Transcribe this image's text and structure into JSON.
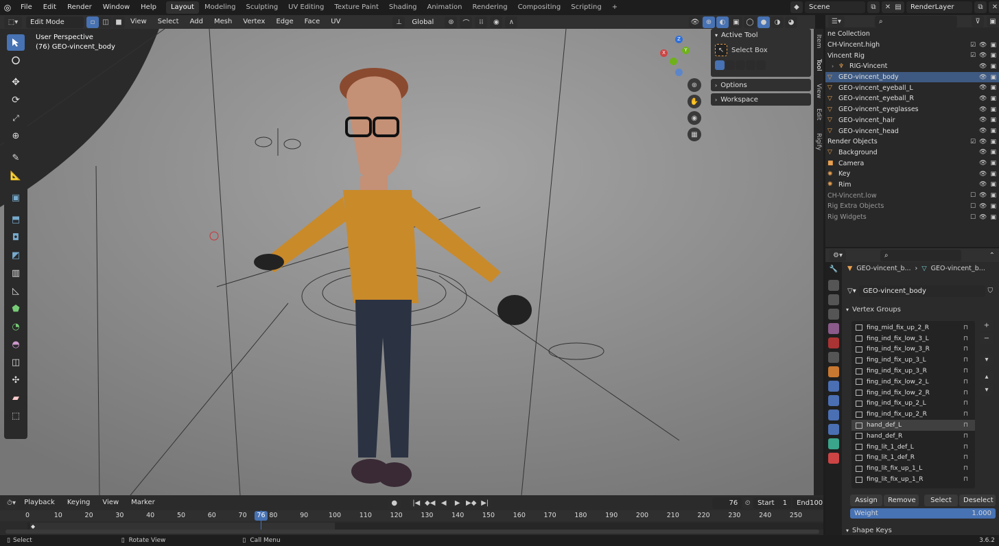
{
  "menu": {
    "items": [
      "File",
      "Edit",
      "Render",
      "Window",
      "Help"
    ]
  },
  "workspaces": [
    "Layout",
    "Modeling",
    "Sculpting",
    "UV Editing",
    "Texture Paint",
    "Shading",
    "Animation",
    "Rendering",
    "Compositing",
    "Scripting"
  ],
  "workspace_add": "+",
  "scene": {
    "name": "Scene",
    "layer": "RenderLayer"
  },
  "viewport_header": {
    "mode": "Edit Mode",
    "menus": [
      "View",
      "Select",
      "Add",
      "Mesh",
      "Vertex",
      "Edge",
      "Face",
      "UV"
    ],
    "orientation": "Global"
  },
  "viewport": {
    "perspective": "User Perspective",
    "object_label": "(76) GEO-vincent_body",
    "gizmo_axes": [
      "Z",
      "Y",
      "X"
    ]
  },
  "npanel": {
    "active_tool_title": "Active Tool",
    "select_box": "Select Box",
    "options": "Options",
    "workspace": "Workspace",
    "tabs": [
      "Item",
      "Tool",
      "View",
      "Edit",
      "Rigify"
    ]
  },
  "outliner": {
    "root": "ne Collection",
    "rows": [
      {
        "name": "CH-Vincent.high",
        "dim": false,
        "sel": false,
        "indent": 0,
        "icon": ""
      },
      {
        "name": "Vincent Rig",
        "dim": false,
        "sel": false,
        "indent": 0,
        "icon": ""
      },
      {
        "name": "RIG-Vincent",
        "dim": false,
        "sel": false,
        "indent": 1,
        "icon": "armature"
      },
      {
        "name": "GEO-vincent_body",
        "dim": false,
        "sel": true,
        "indent": 0,
        "icon": "mesh"
      },
      {
        "name": "GEO-vincent_eyeball_L",
        "dim": false,
        "sel": false,
        "indent": 0,
        "icon": "mesh"
      },
      {
        "name": "GEO-vincent_eyeball_R",
        "dim": false,
        "sel": false,
        "indent": 0,
        "icon": "mesh"
      },
      {
        "name": "GEO-vincent_eyeglasses",
        "dim": false,
        "sel": false,
        "indent": 0,
        "icon": "mesh"
      },
      {
        "name": "GEO-vincent_hair",
        "dim": false,
        "sel": false,
        "indent": 0,
        "icon": "mesh"
      },
      {
        "name": "GEO-vincent_head",
        "dim": false,
        "sel": false,
        "indent": 0,
        "icon": "mesh"
      },
      {
        "name": "Render Objects",
        "dim": false,
        "sel": false,
        "indent": 0,
        "icon": ""
      },
      {
        "name": "Background",
        "dim": false,
        "sel": false,
        "indent": 0,
        "icon": "mesh"
      },
      {
        "name": "Camera",
        "dim": false,
        "sel": false,
        "indent": 0,
        "icon": "camera"
      },
      {
        "name": "Key",
        "dim": false,
        "sel": false,
        "indent": 0,
        "icon": "light"
      },
      {
        "name": "Rim",
        "dim": false,
        "sel": false,
        "indent": 0,
        "icon": "light"
      },
      {
        "name": "CH-Vincent.low",
        "dim": true,
        "sel": false,
        "indent": 0,
        "icon": ""
      },
      {
        "name": "Rig Extra Objects",
        "dim": true,
        "sel": false,
        "indent": 0,
        "icon": ""
      },
      {
        "name": "Rig Widgets",
        "dim": true,
        "sel": false,
        "indent": 0,
        "icon": ""
      }
    ]
  },
  "properties": {
    "breadcrumb": [
      "GEO-vincent_b...",
      "GEO-vincent_b..."
    ],
    "mesh_name": "GEO-vincent_body",
    "vertex_groups_title": "Vertex Groups",
    "groups": [
      "fing_mid_fix_up_2_R",
      "fing_ind_fix_low_3_L",
      "fing_ind_fix_low_3_R",
      "fing_ind_fix_up_3_L",
      "fing_ind_fix_up_3_R",
      "fing_ind_fix_low_2_L",
      "fing_ind_fix_low_2_R",
      "fing_ind_fix_up_2_L",
      "fing_ind_fix_up_2_R",
      "hand_def_L",
      "hand_def_R",
      "fing_lit_1_def_L",
      "fing_lit_1_def_R",
      "fing_lit_fix_up_1_L",
      "fing_lit_fix_up_1_R"
    ],
    "selected_group": "hand_def_L",
    "buttons": {
      "assign": "Assign",
      "remove": "Remove",
      "select": "Select",
      "deselect": "Deselect"
    },
    "weight_label": "Weight",
    "weight_value": "1.000",
    "shape_keys": "Shape Keys"
  },
  "timeline": {
    "menus": [
      "Playback",
      "Keying",
      "View",
      "Marker"
    ],
    "current_frame": "76",
    "start_label": "Start",
    "start": "1",
    "end_label": "End",
    "end": "100",
    "ticks": [
      "0",
      "10",
      "20",
      "30",
      "40",
      "50",
      "60",
      "70",
      "80",
      "90",
      "100",
      "110",
      "120",
      "130",
      "140",
      "150",
      "160",
      "170",
      "180",
      "190",
      "200",
      "210",
      "220",
      "230",
      "240",
      "250"
    ]
  },
  "status": {
    "select": "Select",
    "rotate": "Rotate View",
    "menu": "Call Menu",
    "version": "3.6.2"
  },
  "colors": {
    "accent": "#4772b3",
    "selected_row": "#3e5a82",
    "orange": "#e8a050"
  }
}
